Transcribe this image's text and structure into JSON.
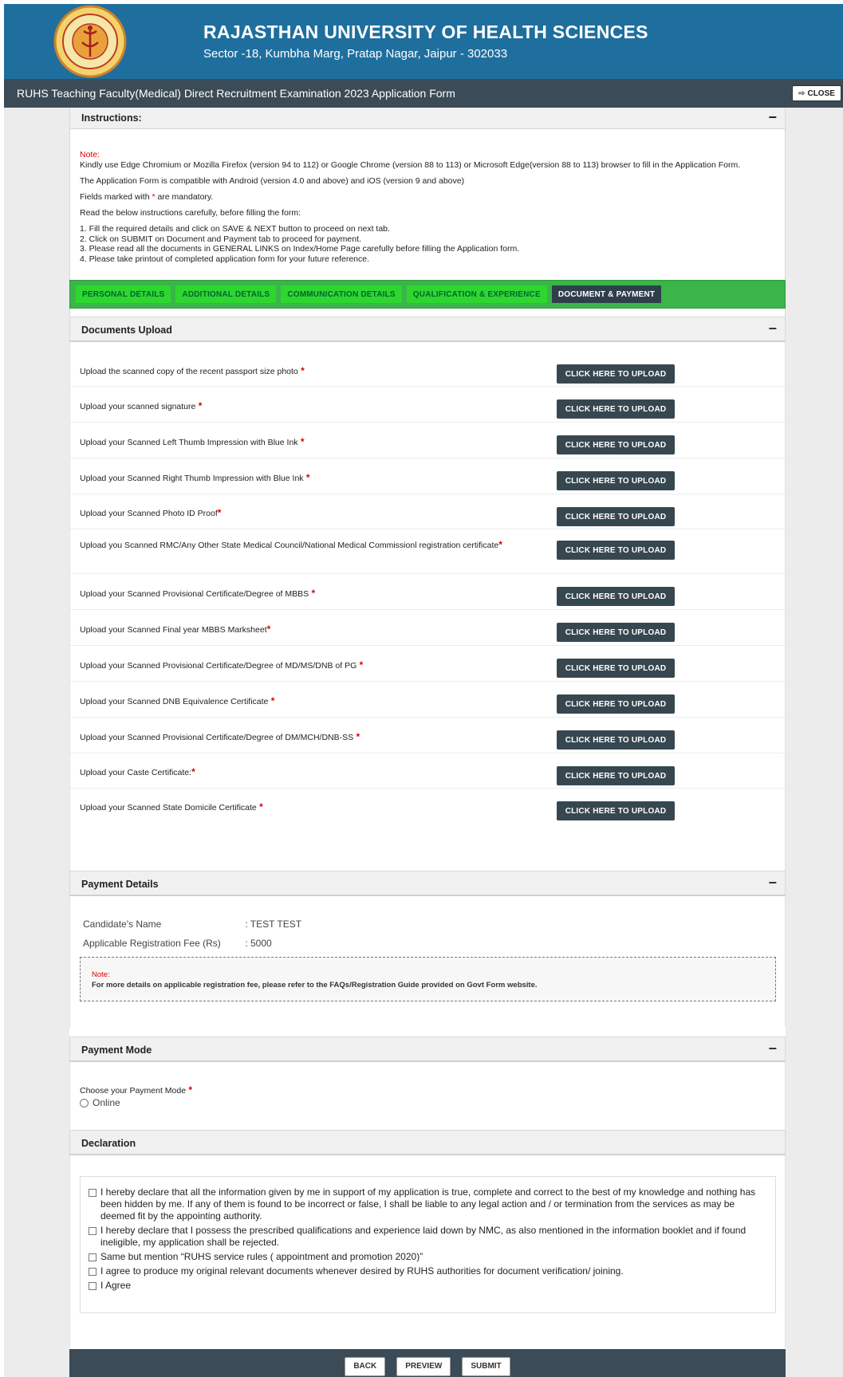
{
  "header": {
    "university": "RAJASTHAN UNIVERSITY OF HEALTH SCIENCES",
    "address": "Sector -18, Kumbha Marg, Pratap Nagar, Jaipur - 302033",
    "form_title": "RUHS Teaching Faculty(Medical) Direct Recruitment Examination 2023 Application Form",
    "close_label": "CLOSE"
  },
  "colors": {
    "header_blue": "#1f6f9e",
    "titlebar": "#3b4b57",
    "tab_green": "#2fd62f",
    "tabbar_green": "#3ab54a",
    "upload_button": "#37474f",
    "required_star": "#dd0000"
  },
  "instructions": {
    "title": "Instructions:",
    "note_label": "Note:",
    "browser_note": "Kindly use Edge Chromium or Mozilla Firefox (version 94 to 112) or Google Chrome (version 88 to 113) or Microsoft Edge(version 88 to 113) browser to fill in the Application Form.",
    "compat_note": "The Application Form is compatible with Android (version 4.0 and above) and iOS (version 9 and above)",
    "mandatory_prefix": "Fields marked with",
    "mandatory_star": "*",
    "mandatory_suffix": "are mandatory.",
    "read_note": "Read the below instructions carefully, before filling the form:",
    "steps": [
      "1. Fill the required details and click on SAVE & NEXT button to proceed on next tab.",
      "2. Click on SUBMIT on Document and Payment tab to proceed for payment.",
      "3. Please read all the documents in GENERAL LINKS on Index/Home Page carefully before filling the Application form.",
      "4. Please take printout of completed application form for your future reference."
    ]
  },
  "tabs": [
    {
      "label": "PERSONAL DETAILS",
      "active": false
    },
    {
      "label": "ADDITIONAL DETAILS",
      "active": false
    },
    {
      "label": "COMMUNICATION DETAILS",
      "active": false
    },
    {
      "label": "QUALIFICATION & EXPERIENCE",
      "active": false
    },
    {
      "label": "DOCUMENT & PAYMENT",
      "active": true
    }
  ],
  "documents": {
    "title": "Documents Upload",
    "button_label": "CLICK HERE TO UPLOAD",
    "items": [
      {
        "label": "Upload the scanned copy of the recent passport size photo",
        "star": " *"
      },
      {
        "label": "Upload your scanned signature",
        "star": " *"
      },
      {
        "label": "Upload your Scanned Left Thumb Impression with Blue Ink",
        "star": " *"
      },
      {
        "label": "Upload your Scanned Right Thumb Impression with Blue Ink",
        "star": " *"
      },
      {
        "label": "Upload your Scanned Photo ID Proof",
        "star": "*"
      },
      {
        "label": "Upload you Scanned RMC/Any Other State Medical Council/National Medical Commissionl registration certificate",
        "star": "*"
      },
      {
        "label": "Upload your Scanned Provisional Certificate/Degree of MBBS",
        "star": " *"
      },
      {
        "label": "Upload your Scanned Final year MBBS Marksheet",
        "star": "*"
      },
      {
        "label": "Upload your Scanned Provisional Certificate/Degree of MD/MS/DNB of PG",
        "star": " *"
      },
      {
        "label": "Upload your Scanned DNB Equivalence Certificate",
        "star": " *"
      },
      {
        "label": "Upload your Scanned Provisional Certificate/Degree of DM/MCH/DNB-SS",
        "star": " *"
      },
      {
        "label": "Upload your Caste Certificate:",
        "star": "*"
      },
      {
        "label": "Upload your Scanned State Domicile Certificate",
        "star": " *"
      }
    ]
  },
  "payment": {
    "title": "Payment Details",
    "name_label": "Candidate's Name",
    "name_value": ":  TEST TEST",
    "fee_label": "Applicable Registration Fee (Rs)",
    "fee_value": ":  5000",
    "note_label": "Note:",
    "note_text": "For more details on applicable registration fee, please refer to the FAQs/Registration Guide provided on Govt Form website."
  },
  "payment_mode": {
    "title": "Payment Mode",
    "label": "Choose your Payment Mode",
    "star": " *",
    "option": "Online"
  },
  "declaration": {
    "title": "Declaration",
    "items": [
      "I hereby declare that all the information given by me in support of my application is true, complete and correct to the best of my knowledge and nothing has been hidden by me. If any of them is found to be incorrect or false, I shall be liable to any legal action and / or termination from the services as may be deemed fit by the appointing authority.",
      "I hereby declare that I possess the prescribed qualifications and experience laid down by NMC, as also mentioned in the information booklet and if found ineligible, my application shall be rejected.",
      "Same but mention “RUHS service rules ( appointment and promotion 2020)”",
      "I agree to produce my original relevant documents whenever desired by RUHS authorities for document verification/ joining.",
      "I Agree"
    ]
  },
  "footer": {
    "back": "BACK",
    "preview": "PREVIEW",
    "submit": "SUBMIT"
  },
  "minus_glyph": "−"
}
